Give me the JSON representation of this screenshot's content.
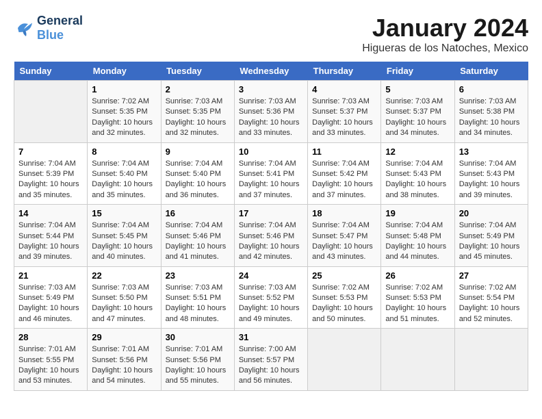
{
  "logo": {
    "line1": "General",
    "line2": "Blue"
  },
  "calendar": {
    "title": "January 2024",
    "subtitle": "Higueras de los Natoches, Mexico"
  },
  "headers": [
    "Sunday",
    "Monday",
    "Tuesday",
    "Wednesday",
    "Thursday",
    "Friday",
    "Saturday"
  ],
  "weeks": [
    [
      {
        "day": "",
        "sunrise": "",
        "sunset": "",
        "daylight": ""
      },
      {
        "day": "1",
        "sunrise": "Sunrise: 7:02 AM",
        "sunset": "Sunset: 5:35 PM",
        "daylight": "Daylight: 10 hours and 32 minutes."
      },
      {
        "day": "2",
        "sunrise": "Sunrise: 7:03 AM",
        "sunset": "Sunset: 5:35 PM",
        "daylight": "Daylight: 10 hours and 32 minutes."
      },
      {
        "day": "3",
        "sunrise": "Sunrise: 7:03 AM",
        "sunset": "Sunset: 5:36 PM",
        "daylight": "Daylight: 10 hours and 33 minutes."
      },
      {
        "day": "4",
        "sunrise": "Sunrise: 7:03 AM",
        "sunset": "Sunset: 5:37 PM",
        "daylight": "Daylight: 10 hours and 33 minutes."
      },
      {
        "day": "5",
        "sunrise": "Sunrise: 7:03 AM",
        "sunset": "Sunset: 5:37 PM",
        "daylight": "Daylight: 10 hours and 34 minutes."
      },
      {
        "day": "6",
        "sunrise": "Sunrise: 7:03 AM",
        "sunset": "Sunset: 5:38 PM",
        "daylight": "Daylight: 10 hours and 34 minutes."
      }
    ],
    [
      {
        "day": "7",
        "sunrise": "Sunrise: 7:04 AM",
        "sunset": "Sunset: 5:39 PM",
        "daylight": "Daylight: 10 hours and 35 minutes."
      },
      {
        "day": "8",
        "sunrise": "Sunrise: 7:04 AM",
        "sunset": "Sunset: 5:40 PM",
        "daylight": "Daylight: 10 hours and 35 minutes."
      },
      {
        "day": "9",
        "sunrise": "Sunrise: 7:04 AM",
        "sunset": "Sunset: 5:40 PM",
        "daylight": "Daylight: 10 hours and 36 minutes."
      },
      {
        "day": "10",
        "sunrise": "Sunrise: 7:04 AM",
        "sunset": "Sunset: 5:41 PM",
        "daylight": "Daylight: 10 hours and 37 minutes."
      },
      {
        "day": "11",
        "sunrise": "Sunrise: 7:04 AM",
        "sunset": "Sunset: 5:42 PM",
        "daylight": "Daylight: 10 hours and 37 minutes."
      },
      {
        "day": "12",
        "sunrise": "Sunrise: 7:04 AM",
        "sunset": "Sunset: 5:43 PM",
        "daylight": "Daylight: 10 hours and 38 minutes."
      },
      {
        "day": "13",
        "sunrise": "Sunrise: 7:04 AM",
        "sunset": "Sunset: 5:43 PM",
        "daylight": "Daylight: 10 hours and 39 minutes."
      }
    ],
    [
      {
        "day": "14",
        "sunrise": "Sunrise: 7:04 AM",
        "sunset": "Sunset: 5:44 PM",
        "daylight": "Daylight: 10 hours and 39 minutes."
      },
      {
        "day": "15",
        "sunrise": "Sunrise: 7:04 AM",
        "sunset": "Sunset: 5:45 PM",
        "daylight": "Daylight: 10 hours and 40 minutes."
      },
      {
        "day": "16",
        "sunrise": "Sunrise: 7:04 AM",
        "sunset": "Sunset: 5:46 PM",
        "daylight": "Daylight: 10 hours and 41 minutes."
      },
      {
        "day": "17",
        "sunrise": "Sunrise: 7:04 AM",
        "sunset": "Sunset: 5:46 PM",
        "daylight": "Daylight: 10 hours and 42 minutes."
      },
      {
        "day": "18",
        "sunrise": "Sunrise: 7:04 AM",
        "sunset": "Sunset: 5:47 PM",
        "daylight": "Daylight: 10 hours and 43 minutes."
      },
      {
        "day": "19",
        "sunrise": "Sunrise: 7:04 AM",
        "sunset": "Sunset: 5:48 PM",
        "daylight": "Daylight: 10 hours and 44 minutes."
      },
      {
        "day": "20",
        "sunrise": "Sunrise: 7:04 AM",
        "sunset": "Sunset: 5:49 PM",
        "daylight": "Daylight: 10 hours and 45 minutes."
      }
    ],
    [
      {
        "day": "21",
        "sunrise": "Sunrise: 7:03 AM",
        "sunset": "Sunset: 5:49 PM",
        "daylight": "Daylight: 10 hours and 46 minutes."
      },
      {
        "day": "22",
        "sunrise": "Sunrise: 7:03 AM",
        "sunset": "Sunset: 5:50 PM",
        "daylight": "Daylight: 10 hours and 47 minutes."
      },
      {
        "day": "23",
        "sunrise": "Sunrise: 7:03 AM",
        "sunset": "Sunset: 5:51 PM",
        "daylight": "Daylight: 10 hours and 48 minutes."
      },
      {
        "day": "24",
        "sunrise": "Sunrise: 7:03 AM",
        "sunset": "Sunset: 5:52 PM",
        "daylight": "Daylight: 10 hours and 49 minutes."
      },
      {
        "day": "25",
        "sunrise": "Sunrise: 7:02 AM",
        "sunset": "Sunset: 5:53 PM",
        "daylight": "Daylight: 10 hours and 50 minutes."
      },
      {
        "day": "26",
        "sunrise": "Sunrise: 7:02 AM",
        "sunset": "Sunset: 5:53 PM",
        "daylight": "Daylight: 10 hours and 51 minutes."
      },
      {
        "day": "27",
        "sunrise": "Sunrise: 7:02 AM",
        "sunset": "Sunset: 5:54 PM",
        "daylight": "Daylight: 10 hours and 52 minutes."
      }
    ],
    [
      {
        "day": "28",
        "sunrise": "Sunrise: 7:01 AM",
        "sunset": "Sunset: 5:55 PM",
        "daylight": "Daylight: 10 hours and 53 minutes."
      },
      {
        "day": "29",
        "sunrise": "Sunrise: 7:01 AM",
        "sunset": "Sunset: 5:56 PM",
        "daylight": "Daylight: 10 hours and 54 minutes."
      },
      {
        "day": "30",
        "sunrise": "Sunrise: 7:01 AM",
        "sunset": "Sunset: 5:56 PM",
        "daylight": "Daylight: 10 hours and 55 minutes."
      },
      {
        "day": "31",
        "sunrise": "Sunrise: 7:00 AM",
        "sunset": "Sunset: 5:57 PM",
        "daylight": "Daylight: 10 hours and 56 minutes."
      },
      {
        "day": "",
        "sunrise": "",
        "sunset": "",
        "daylight": ""
      },
      {
        "day": "",
        "sunrise": "",
        "sunset": "",
        "daylight": ""
      },
      {
        "day": "",
        "sunrise": "",
        "sunset": "",
        "daylight": ""
      }
    ]
  ]
}
